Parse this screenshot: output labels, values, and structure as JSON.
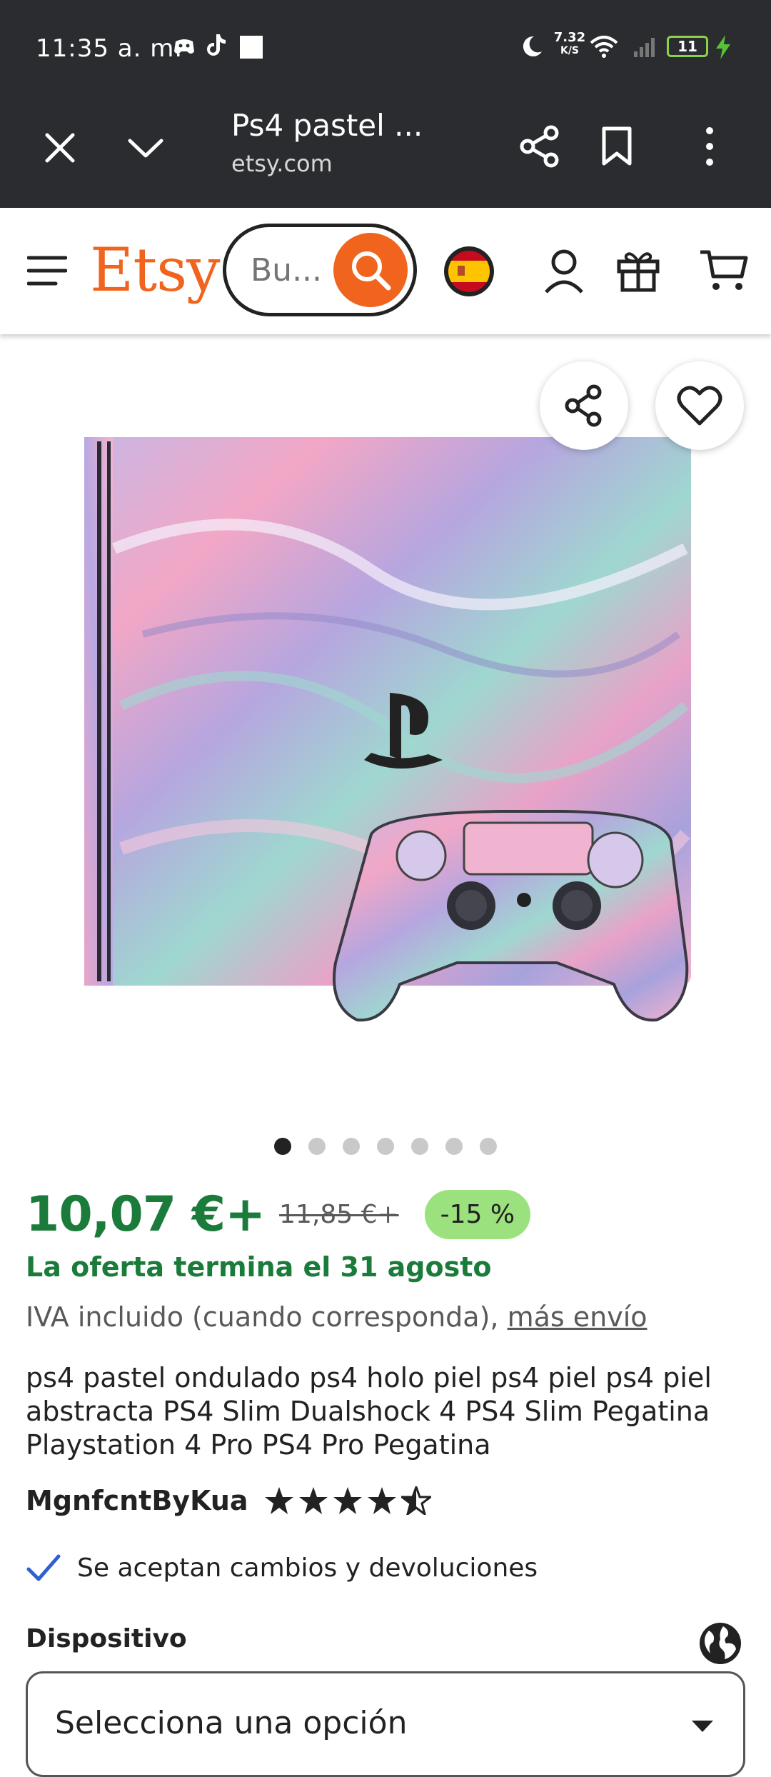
{
  "status_bar": {
    "time": "11:35 a. m.",
    "net_speed_value": "7.32",
    "net_speed_unit": "K/S",
    "battery": "11"
  },
  "browser": {
    "title": "Ps4 pastel ...",
    "domain": "etsy.com"
  },
  "header": {
    "logo": "Etsy",
    "search_placeholder": "Bu..."
  },
  "product": {
    "image_count": 7,
    "active_image": 1,
    "price": "10,07 €+",
    "old_price": "11,85 €+",
    "discount": "-15 %",
    "offer_text": "La oferta termina el 31 agosto",
    "vat_text": "IVA incluido (cuando corresponda), ",
    "shipping_link": "más envío",
    "title": "ps4 pastel ondulado ps4 holo piel ps4 piel ps4 piel abstracta PS4 Slim Dualshock 4 PS4 Slim Pegatina Playstation 4 Pro PS4 Pro Pegatina",
    "shop_name": "MgnfcntByKua",
    "rating": 4.5,
    "returns_text": "Se aceptan cambios y devoluciones",
    "option_label": "Dispositivo",
    "select_value": "Selecciona una opción"
  },
  "colors": {
    "etsy_orange": "#f1641e",
    "price_green": "#1b7b3a",
    "discount_bg": "#9be27e",
    "check_blue": "#2f5fd0"
  }
}
